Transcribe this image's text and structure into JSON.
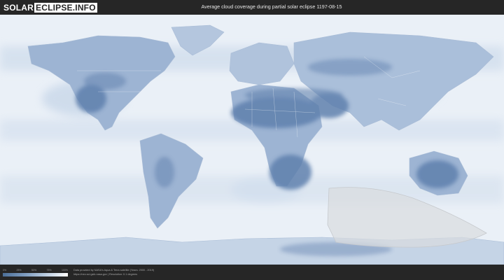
{
  "header": {
    "logo_part1": "SOLAR",
    "logo_part2": "ECLIPSE.INFO",
    "title": "Average cloud coverage during partial solar eclipse 1197-08-15"
  },
  "map": {
    "ocean_color": "#eef3f9",
    "clear_sky_color": "#5a7cab",
    "eclipse_zone_color": "#d9dbde"
  },
  "footer": {
    "legend_ticks": [
      "0%",
      "25%",
      "50%",
      "75%",
      "100%"
    ],
    "attribution_line1": "Data provided by NASA's Aqua & Terra satellite (Years: 2000 - 2019)",
    "attribution_line2": "https://neo.sci.gsfc.nasa.gov | Resolution: 0.1 degrees"
  }
}
